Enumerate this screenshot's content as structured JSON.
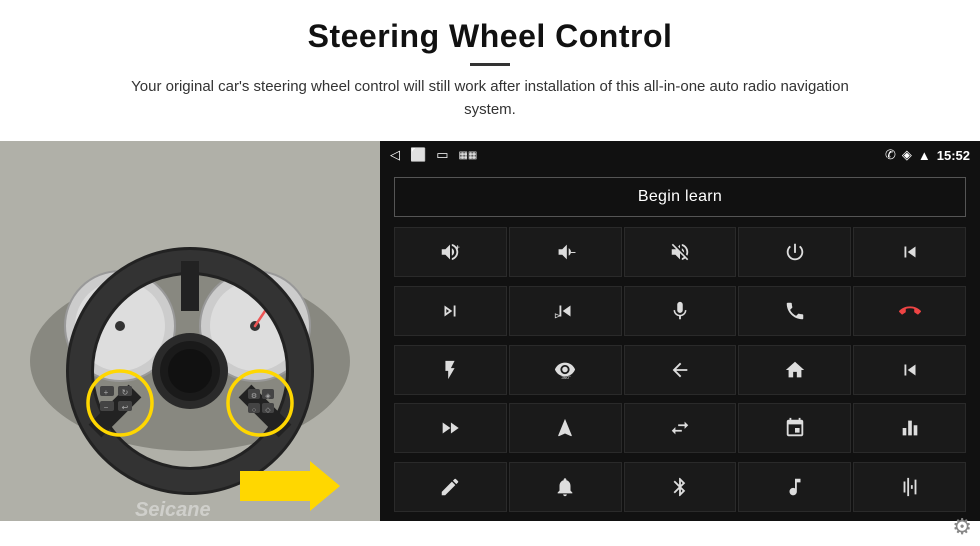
{
  "header": {
    "title": "Steering Wheel Control",
    "description": "Your original car's steering wheel control will still work after installation of this all-in-one auto radio navigation system."
  },
  "screen": {
    "status_bar": {
      "time": "15:52",
      "back_icon": "◁",
      "home_icon": "□",
      "recents_icon": "▭",
      "notification_icon": "▦",
      "phone_icon": "✆",
      "wifi_icon": "◈",
      "signal_icon": "▲"
    },
    "begin_learn_label": "Begin learn",
    "controls": [
      {
        "icon": "vol_up",
        "label": "Volume Up"
      },
      {
        "icon": "vol_down",
        "label": "Volume Down"
      },
      {
        "icon": "vol_mute",
        "label": "Mute"
      },
      {
        "icon": "power",
        "label": "Power"
      },
      {
        "icon": "prev_track",
        "label": "Previous Track"
      },
      {
        "icon": "next",
        "label": "Next"
      },
      {
        "icon": "prev_skip",
        "label": "Previous Skip"
      },
      {
        "icon": "mic",
        "label": "Mic"
      },
      {
        "icon": "phone",
        "label": "Phone"
      },
      {
        "icon": "hang_up",
        "label": "Hang Up"
      },
      {
        "icon": "flashlight",
        "label": "Flashlight"
      },
      {
        "icon": "360",
        "label": "360 View"
      },
      {
        "icon": "back",
        "label": "Back"
      },
      {
        "icon": "home",
        "label": "Home"
      },
      {
        "icon": "skip_prev",
        "label": "Skip Previous"
      },
      {
        "icon": "ff",
        "label": "Fast Forward"
      },
      {
        "icon": "navigate",
        "label": "Navigate"
      },
      {
        "icon": "swap",
        "label": "Swap"
      },
      {
        "icon": "record",
        "label": "Record"
      },
      {
        "icon": "equalizer",
        "label": "Equalizer"
      },
      {
        "icon": "pen",
        "label": "Pen"
      },
      {
        "icon": "ring",
        "label": "Ring"
      },
      {
        "icon": "bluetooth",
        "label": "Bluetooth"
      },
      {
        "icon": "music",
        "label": "Music"
      },
      {
        "icon": "waveform",
        "label": "Waveform"
      }
    ],
    "gear_icon": "⚙",
    "watermark": "Seicane"
  }
}
